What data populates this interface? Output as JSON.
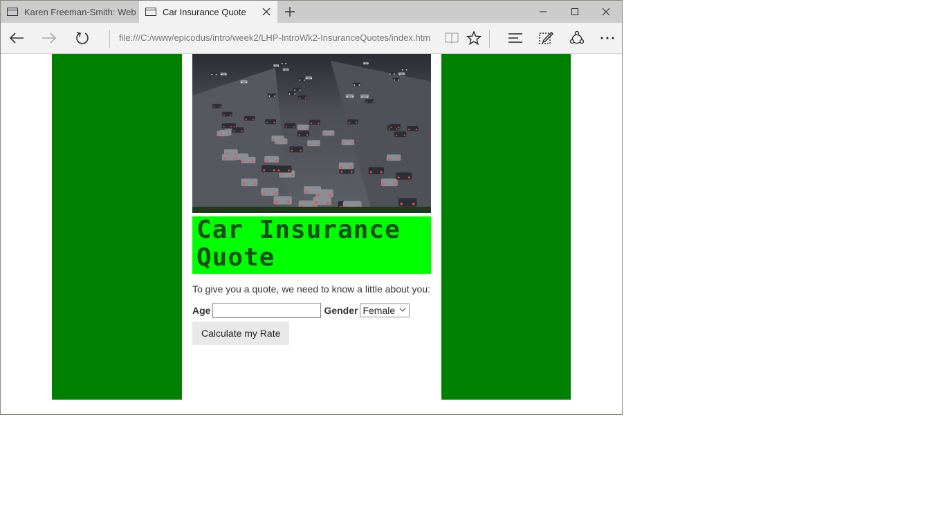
{
  "browser": {
    "tabs": [
      {
        "title": "Karen Freeman-Smith: Web",
        "active": false
      },
      {
        "title": "Car Insurance Quote",
        "active": true
      }
    ],
    "address": "file:///C:/www/epicodus/intro/week2/LHP-IntroWk2-InsuranceQuotes/index.htm"
  },
  "page": {
    "title": "Car Insurance Quote",
    "intro": "To give you a quote, we need to know a little about you:",
    "form": {
      "age_label": "Age",
      "age_value": "",
      "gender_label": "Gender",
      "gender_selected": "Female",
      "submit_label": "Calculate my Rate"
    }
  },
  "colors": {
    "sidebar": "#008000",
    "title_band": "#00ff00",
    "title_text": "#1a4d1a"
  }
}
